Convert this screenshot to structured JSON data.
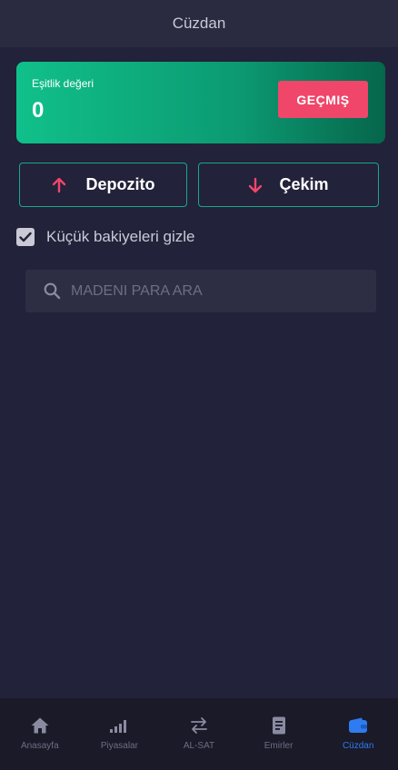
{
  "header": {
    "title": "Cüzdan"
  },
  "equity": {
    "label": "Eşitlik değeri",
    "value": "0",
    "history_label": "GEÇMIŞ"
  },
  "actions": {
    "deposit_label": "Depozito",
    "withdraw_label": "Çekim"
  },
  "hide_small_balances": {
    "label": "Küçük bakiyeleri gizle",
    "checked": true
  },
  "search": {
    "placeholder": "MADENI PARA ARA",
    "value": ""
  },
  "bottom_nav": {
    "items": [
      {
        "label": "Anasayfa",
        "icon": "home-icon",
        "active": false
      },
      {
        "label": "Piyasalar",
        "icon": "bar-chart-icon",
        "active": false
      },
      {
        "label": "AL-SAT",
        "icon": "swap-icon",
        "active": false
      },
      {
        "label": "Emirler",
        "icon": "document-icon",
        "active": false
      },
      {
        "label": "Cüzdan",
        "icon": "wallet-icon",
        "active": true
      }
    ]
  },
  "colors": {
    "background": "#22223a",
    "card_gradient_start": "#10c08a",
    "card_gradient_end": "#06664b",
    "accent_red": "#f0466a",
    "accent_green": "#1aa886",
    "active_blue": "#2f7bf0",
    "muted_text": "#c9cad6"
  }
}
